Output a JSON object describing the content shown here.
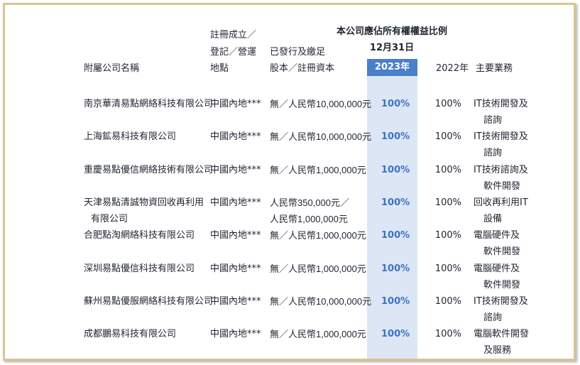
{
  "headers": {
    "company_name": "附屬公司名稱",
    "place_line1": "註冊成立／",
    "place_line2": "登記／營運",
    "place_line3": "地點",
    "capital_line1": "已發行及繳足",
    "capital_line2": "股本／註冊資本",
    "interest_line1": "本公司應佔所有權權益比例",
    "interest_line2": "12月31日",
    "year_2023": "2023年",
    "year_2022": "2022年",
    "business": "主要業務"
  },
  "rows": [
    {
      "name": "南京華清易點網絡科技有限公司",
      "place": "中國內地***",
      "capital": "無／人民幣10,000,000元",
      "pct2023": "100%",
      "pct2022": "100%",
      "business1": "IT技術開發及",
      "business2": "諮詢"
    },
    {
      "name": "上海鉱易科技有限公司",
      "place": "中國內地***",
      "capital": "無／人民幣10,000,000元",
      "pct2023": "100%",
      "pct2022": "100%",
      "business1": "IT技術開發及",
      "business2": "諮詢"
    },
    {
      "name": "重慶易點優信網絡技術有限公司",
      "place": "中國內地***",
      "capital": "無／人民幣1,000,000元",
      "pct2023": "100%",
      "pct2022": "100%",
      "business1": "IT技術諮詢及",
      "business2": "軟件開發"
    },
    {
      "name": "天津易點清誠物資回收再利用",
      "name2": "有限公司",
      "place": "中國內地***",
      "capital": "人民幣350,000元／",
      "capital2": "人民幣1,000,000元",
      "pct2023": "100%",
      "pct2022": "100%",
      "business1": "回收再利用IT",
      "business2": "設備"
    },
    {
      "name": "合肥點淘網絡科技有限公司",
      "place": "中國內地***",
      "capital": "無／人民幣1,000,000元",
      "pct2023": "100%",
      "pct2022": "100%",
      "business1": "電腦硬件及",
      "business2": "軟件開發"
    },
    {
      "name": "深圳易點優信科技有限公司",
      "place": "中國內地***",
      "capital": "無／人民幣1,000,000元",
      "pct2023": "100%",
      "pct2022": "100%",
      "business1": "電腦硬件及",
      "business2": "軟件開發"
    },
    {
      "name": "蘇州易點優服網絡科技有限公司",
      "place": "中國內地***",
      "capital": "無／人民幣10,000,000元",
      "pct2023": "100%",
      "pct2022": "100%",
      "business1": "IT技術開發及",
      "business2": "諮詢"
    },
    {
      "name": "成都鵬易科技有限公司",
      "place": "中國內地***",
      "capital": "無／人民幣1,000,000元",
      "pct2023": "100%",
      "pct2022": "100%",
      "business1": "電腦軟件開發",
      "business2": "及服務"
    }
  ]
}
